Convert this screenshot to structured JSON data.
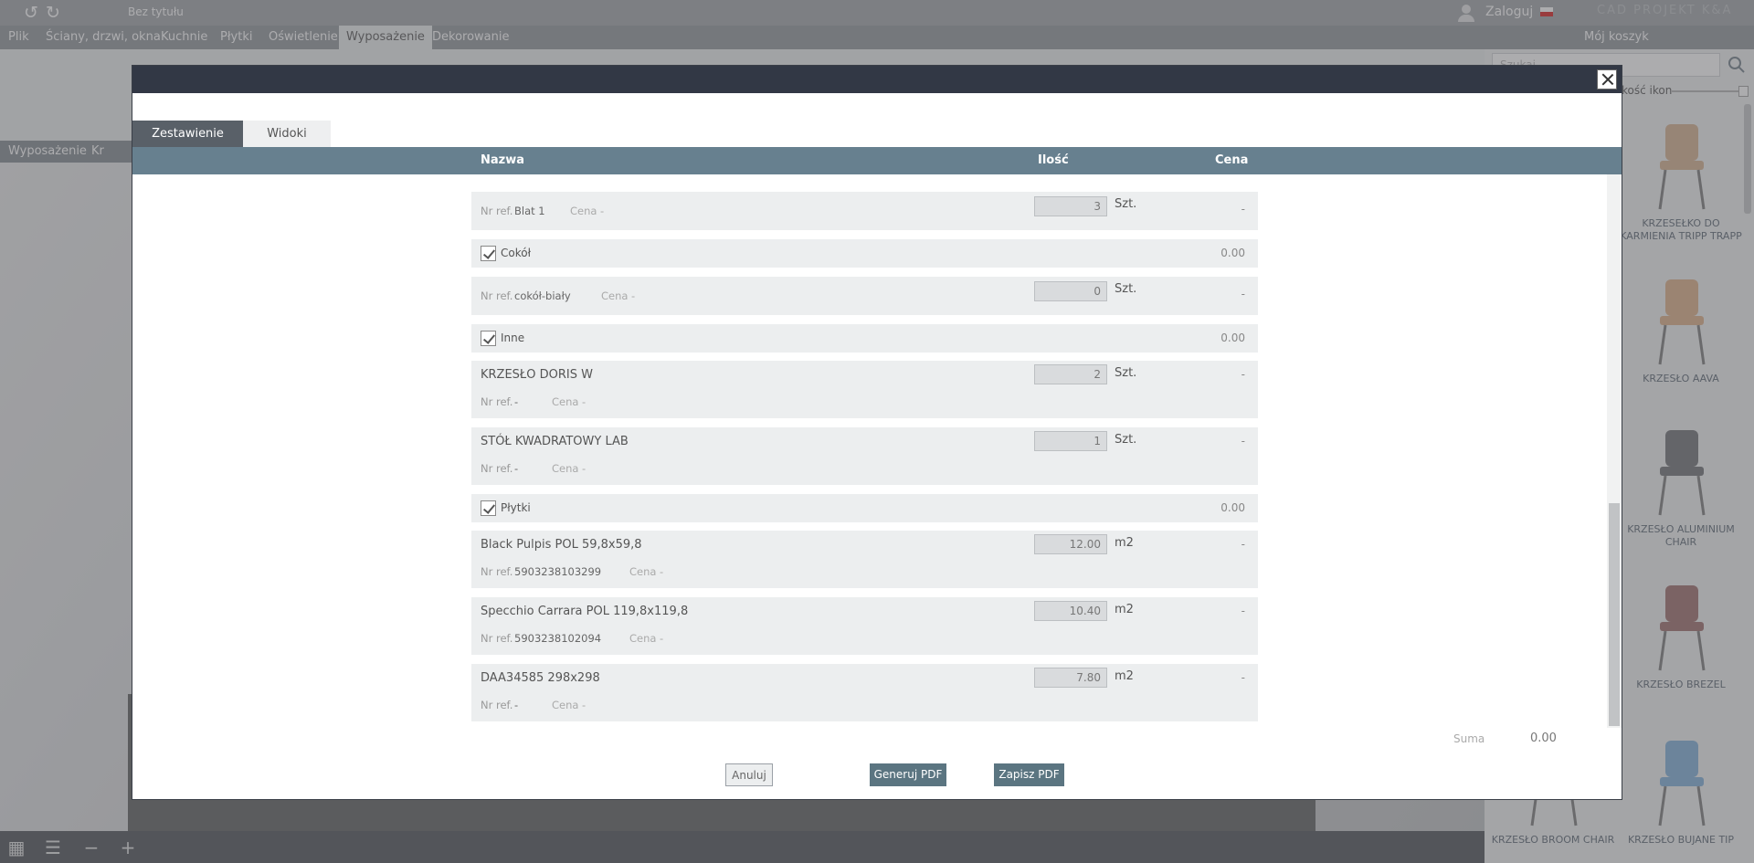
{
  "app": {
    "doc_title": "Bez tytułu",
    "login": "Zaloguj",
    "brand": "CAD PROJEKT K&A",
    "menu": [
      "Plik",
      "Ściany, drzwi, okna",
      "Kuchnie",
      "Płytki",
      "Oświetlenie",
      "Wyposażenie",
      "Dekorowanie"
    ],
    "active_menu": "Wyposażenie",
    "cart": "Mój koszyk",
    "breadcrumb": [
      "Wyposażenie",
      "Kr"
    ],
    "search_placeholder": "Szukaj",
    "icon_size_label": "kość ikon",
    "products": [
      {
        "name": "KRZESEŁKO DO KARMIENIA TRIPP TRAPP"
      },
      {
        "name": "KRZESŁO AAVA"
      },
      {
        "name": "KRZESŁO ALUMINIUM CHAIR"
      },
      {
        "name": "KRZESŁO BREZEL"
      },
      {
        "name": "KRZESŁO BUJANE TIP"
      },
      {
        "name": "KRZESŁO BROOM CHAIR"
      }
    ]
  },
  "dialog": {
    "tabs": {
      "summary": "Zestawienie",
      "views": "Widoki"
    },
    "columns": {
      "name": "Nazwa",
      "qty": "Ilość",
      "price": "Cena"
    },
    "labels": {
      "ref": "Nr ref.",
      "price": "Cena"
    },
    "items": [
      {
        "kind": "item",
        "name": "",
        "ref": "Blat 1",
        "price_val": "-",
        "qty": "3",
        "unit": "Szt.",
        "price": "-"
      },
      {
        "kind": "category",
        "name": "Cokół",
        "total": "0.00"
      },
      {
        "kind": "item",
        "name": "",
        "ref": "cokół-biały",
        "price_val": "-",
        "qty": "0",
        "unit": "Szt.",
        "price": "-"
      },
      {
        "kind": "category",
        "name": "Inne",
        "total": "0.00"
      },
      {
        "kind": "item",
        "name": "KRZESŁO DORIS W",
        "ref": "-",
        "price_val": "-",
        "qty": "2",
        "unit": "Szt.",
        "price": "-"
      },
      {
        "kind": "item",
        "name": "STÓŁ KWADRATOWY LAB",
        "ref": "-",
        "price_val": "-",
        "qty": "1",
        "unit": "Szt.",
        "price": "-"
      },
      {
        "kind": "category",
        "name": "Płytki",
        "total": "0.00"
      },
      {
        "kind": "item",
        "name": "Black Pulpis POL 59,8x59,8",
        "ref": "5903238103299",
        "price_val": "-",
        "qty": "12.00",
        "unit": "m2",
        "price": "-"
      },
      {
        "kind": "item",
        "name": "Specchio Carrara POL 119,8x119,8",
        "ref": "5903238102094",
        "price_val": "-",
        "qty": "10.40",
        "unit": "m2",
        "price": "-"
      },
      {
        "kind": "item",
        "name": "DAA34585 298x298",
        "ref": "-",
        "price_val": "-",
        "qty": "7.80",
        "unit": "m2",
        "price": "-"
      }
    ],
    "sum_label": "Suma",
    "sum_value": "0.00",
    "buttons": {
      "cancel": "Anuluj",
      "generate": "Generuj PDF",
      "save": "Zapisz PDF"
    }
  }
}
